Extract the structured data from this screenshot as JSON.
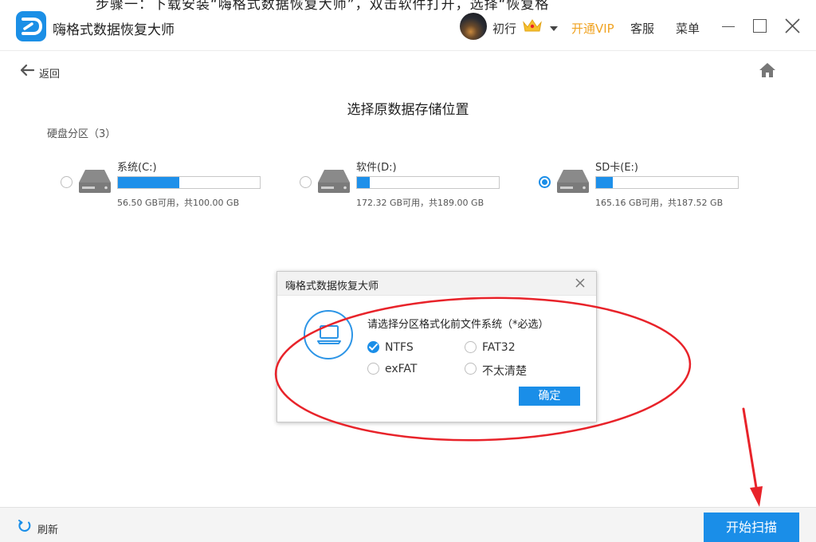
{
  "header": {
    "cut_text": "步骤一：下载安装“嗨格式数据恢复大师”，双击软件打开，选择“恢复格",
    "app_title": "嗨格式数据恢复大师",
    "user_name": "初行",
    "vip_label": "开通VIP",
    "service_label": "客服",
    "menu_label": "菜单"
  },
  "nav": {
    "back_label": "返回"
  },
  "main": {
    "heading": "选择原数据存储位置",
    "section_label": "硬盘分区（3）",
    "drives": [
      {
        "name": "系统(C:)",
        "usage": "56.50 GB可用，共100.00 GB",
        "used_fraction": 0.435,
        "selected": false
      },
      {
        "name": "软件(D:)",
        "usage": "172.32 GB可用，共189.00 GB",
        "used_fraction": 0.088,
        "selected": false
      },
      {
        "name": "SD卡(E:)",
        "usage": "165.16 GB可用，共187.52 GB",
        "used_fraction": 0.119,
        "selected": true
      }
    ]
  },
  "dialog": {
    "title": "嗨格式数据恢复大师",
    "prompt": "请选择分区格式化前文件系统（*必选）",
    "options": [
      {
        "label": "NTFS",
        "checked": true
      },
      {
        "label": "FAT32",
        "checked": false
      },
      {
        "label": "exFAT",
        "checked": false
      },
      {
        "label": "不太清楚",
        "checked": false
      }
    ],
    "confirm_label": "确定"
  },
  "footer": {
    "refresh_label": "刷新",
    "scan_label": "开始扫描"
  },
  "colors": {
    "accent": "#1a8ee8",
    "vip": "#f0a322",
    "annotation": "#e8232a"
  },
  "icons": [
    "app-logo-icon",
    "crown-icon",
    "chevron-down-icon",
    "minimize-icon",
    "maximize-icon",
    "close-icon",
    "back-arrow-icon",
    "home-icon",
    "hard-disk-icon",
    "laptop-icon",
    "checkmark-icon",
    "refresh-icon"
  ]
}
